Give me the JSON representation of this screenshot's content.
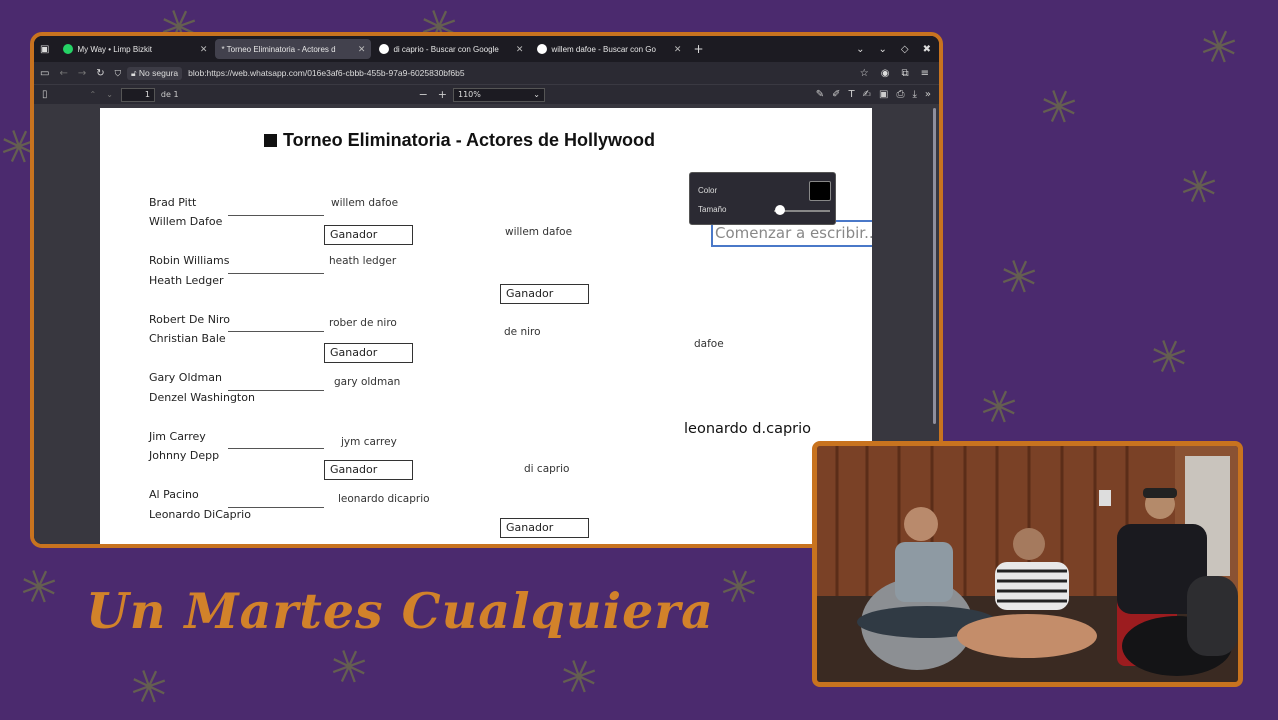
{
  "browser": {
    "tabs": [
      {
        "label": "My Way • Limp Bizkit",
        "active": false
      },
      {
        "label": "* Torneo Eliminatoria - Actores d",
        "active": true
      },
      {
        "label": "di caprio - Buscar con Google",
        "active": false
      },
      {
        "label": "willem dafoe - Buscar con Go",
        "active": false
      }
    ],
    "security_label": "No segura",
    "url": "blob:https://web.whatsapp.com/016e3af6-cbbb-455b-97a9-6025830bf6b5",
    "pdf": {
      "page_number": "1",
      "page_total": "de 1",
      "zoom": "110%"
    },
    "text_popup": {
      "color_label": "Color",
      "size_label": "Tamaño",
      "color_value": "#000000",
      "size_level": 0.1
    }
  },
  "document": {
    "title": "Torneo Eliminatoria - Actores de Hollywood",
    "round1": [
      {
        "top": "Brad Pitt",
        "bottom": "Willem Dafoe"
      },
      {
        "top": "Robin Williams",
        "bottom": "Heath Ledger"
      },
      {
        "top": "Robert De Niro",
        "bottom": "Christian Bale"
      },
      {
        "top": "Gary Oldman",
        "bottom": "Denzel Washington"
      },
      {
        "top": "Jim Carrey",
        "bottom": "Johnny Depp"
      },
      {
        "top": "Al Pacino",
        "bottom": "Leonardo DiCaprio"
      }
    ],
    "round1_winners": [
      "willem dafoe",
      "heath ledger",
      "rober de niro",
      "gary oldman",
      "jym carrey",
      "leonardo dicaprio"
    ],
    "winner_box_label": "Ganador",
    "round2_winners": [
      "willem dafoe",
      "de niro",
      "di caprio"
    ],
    "round3_winner": "dafoe",
    "final_name": "leonardo d.caprio",
    "typing_placeholder": "Comenzar a escribir..."
  },
  "show_title": "Un Martes Cualquiera",
  "colors": {
    "background": "#4b2a6e",
    "frame_accent": "#c8731f",
    "title_accent": "#d2822a"
  }
}
